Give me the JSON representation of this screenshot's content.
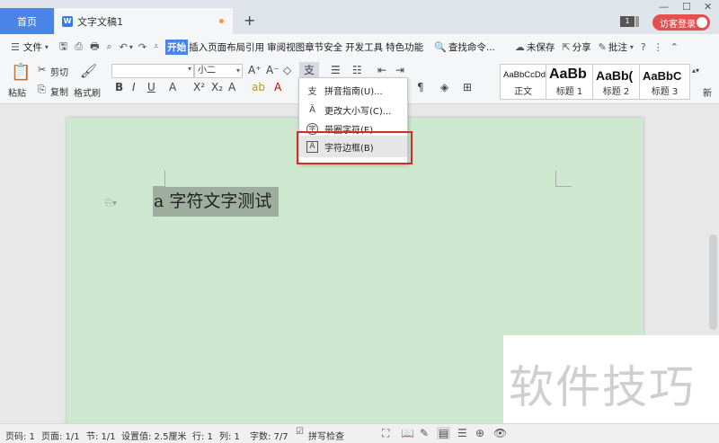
{
  "tabs": {
    "home": "首页",
    "doc_title": "文字文稿1",
    "add": "+",
    "window_count": "1",
    "login": "访客登录"
  },
  "menu": {
    "file": "文件",
    "items": [
      "开始",
      "插入",
      "页面布局",
      "引用",
      "审阅",
      "视图",
      "章节",
      "安全",
      "开发工具",
      "特色功能"
    ],
    "search": "查找命令...",
    "unsaved": "未保存",
    "share": "分享",
    "comment": "批注"
  },
  "ribbon": {
    "paste": "粘贴",
    "cut": "剪切",
    "copy": "复制",
    "format_painter": "格式刷",
    "font_name": "",
    "font_size": "小二",
    "styles": [
      {
        "sample": "AaBbCcDd",
        "name": "正文"
      },
      {
        "sample": "AaBb",
        "name": "标题 1"
      },
      {
        "sample": "AaBb(",
        "name": "标题 2"
      },
      {
        "sample": "AaBbC",
        "name": "标题 3"
      }
    ],
    "more": "新"
  },
  "dropdown": {
    "items": [
      {
        "icon": "支",
        "label": "拼音指南(U)..."
      },
      {
        "icon": "Ȁ",
        "label": "更改大小写(C)..."
      },
      {
        "icon": "字",
        "label": "带圈字符(E)..."
      },
      {
        "icon": "A",
        "label": "字符边框(B)"
      }
    ]
  },
  "document": {
    "text_a": "a",
    "text_main": " 字符文字测试"
  },
  "watermark": "软件技巧",
  "status": {
    "page_num": "页码: 1",
    "pages": "页面: 1/1",
    "section": "节: 1/1",
    "setting": "设置值: 2.5厘米",
    "row": "行: 1",
    "col": "列: 1",
    "words": "字数: 7/7",
    "spell": "拼写检查"
  }
}
